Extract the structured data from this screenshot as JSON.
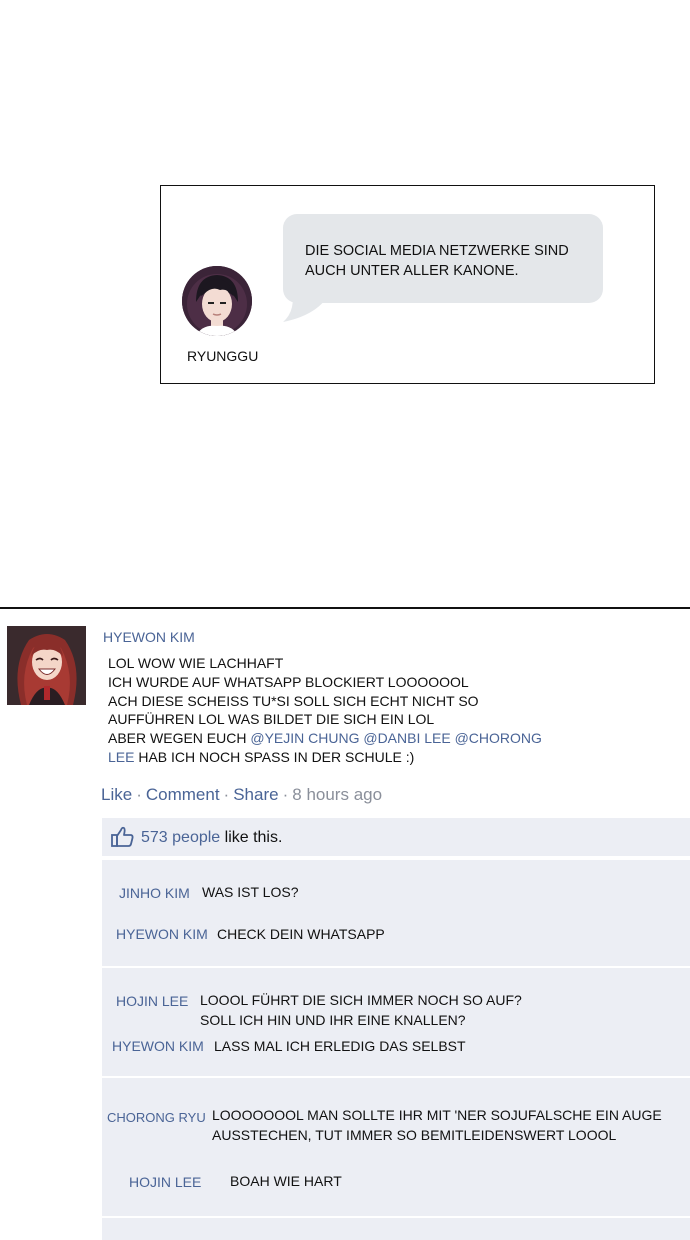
{
  "panel": {
    "name": "RYUNGGU",
    "message_line1": "DIE SOCIAL MEDIA NETZWERKE SIND",
    "message_line2": "AUCH UNTER ALLER KANONE."
  },
  "post": {
    "author": "HYEWON KIM",
    "lines": [
      "LOL WOW WIE LACHHAFT",
      "ICH WURDE AUF WHATSAPP BLOCKIERT LOOOOOOL",
      "ACH DIESE SCHEISS TU*SI SOLL SICH ECHT NICHT SO",
      "AUFFÜHREN LOL  WAS BILDET DIE SICH EIN LOL"
    ],
    "line5_prefix": "ABER WEGEN EUCH ",
    "line5_mentions": "@YEJIN CHUNG @DANBI LEE @CHORONG",
    "line6_mention": "LEE",
    "line6_rest": " HAB ICH NOCH SPASS IN DER SCHULE :)",
    "actions": {
      "like": "Like",
      "comment": "Comment",
      "share": "Share",
      "separator": "·",
      "time": "8 hours ago"
    },
    "likes": {
      "count_text": "573 people",
      "rest_text": " like this."
    }
  },
  "comments": [
    {
      "name": "JINHO KIM",
      "text": "WAS IST LOS?"
    },
    {
      "name": "HYEWON KIM",
      "text": "CHECK DEIN WHATSAPP"
    },
    {
      "name": "HOJIN LEE",
      "text_line1": "LOOOL FÜHRT DIE SICH IMMER NOCH SO AUF?",
      "text_line2": "SOLL ICH HIN UND IHR EINE KNALLEN?"
    },
    {
      "name": "HYEWON KIM",
      "text": "LASS MAL ICH ERLEDIG DAS SELBST"
    },
    {
      "name": "CHORONG RYU",
      "text_line1": "LOOOOOOOL MAN SOLLTE IHR MIT 'NER SOJUFALSCHE EIN AUGE",
      "text_line2": "AUSSTECHEN, TUT IMMER SO BEMITLEIDENSWERT LOOOL"
    },
    {
      "name": "HOJIN LEE",
      "text": "BOAH WIE HART"
    }
  ],
  "colors": {
    "link_blue": "#4a6496",
    "comment_bg": "#eceef4",
    "bubble_bg": "#e4e7ea",
    "muted_gray": "#8a8f9a"
  },
  "icons": {
    "thumb": "thumbs-up-icon"
  }
}
